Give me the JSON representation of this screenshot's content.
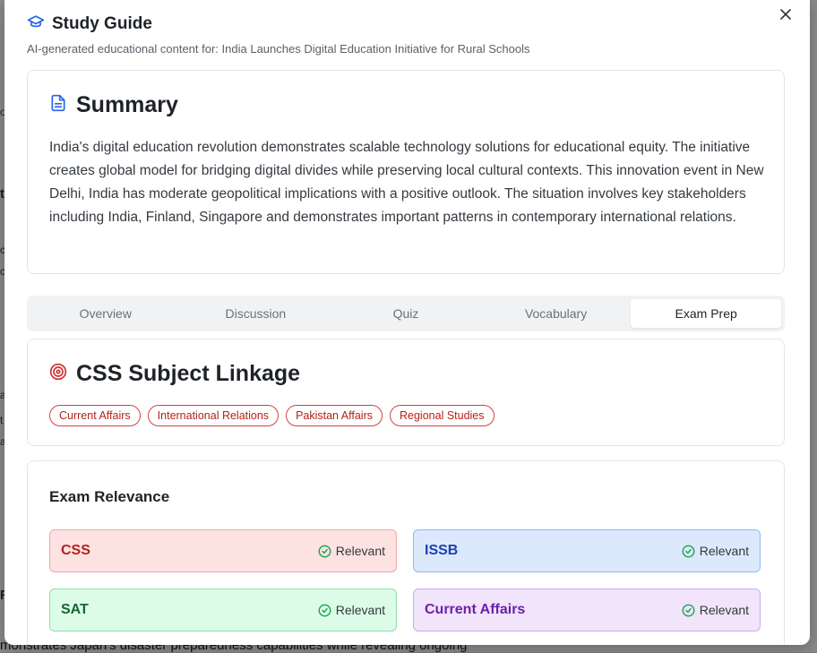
{
  "background": {
    "bottom_text": "monstrates Japan's disaster preparedness capabilities while revealing ongoing",
    "fragments": [
      "o",
      "t",
      "c",
      "c",
      "a",
      "t",
      "a",
      "F"
    ]
  },
  "header": {
    "title": "Study Guide",
    "subtitle": "AI-generated educational content for: India Launches Digital Education Initiative for Rural Schools",
    "icon": "graduation-cap-icon"
  },
  "summary": {
    "title": "Summary",
    "icon": "document-icon",
    "text": "India's digital education revolution demonstrates scalable technology solutions for educational equity. The initiative creates global model for bridging digital divides while preserving local cultural contexts. This innovation event in New Delhi, India has moderate geopolitical implications with a positive outlook. The situation involves key stakeholders including India, Finland, Singapore and demonstrates important patterns in contemporary international relations."
  },
  "tabs": [
    {
      "label": "Overview"
    },
    {
      "label": "Discussion"
    },
    {
      "label": "Quiz"
    },
    {
      "label": "Vocabulary"
    },
    {
      "label": "Exam Prep",
      "active": true
    }
  ],
  "linkage": {
    "title": "CSS Subject Linkage",
    "icon": "target-icon",
    "tags": [
      "Current Affairs",
      "International Relations",
      "Pakistan Affairs",
      "Regional Studies"
    ]
  },
  "exam": {
    "title": "Exam Relevance",
    "items": [
      {
        "name": "CSS",
        "status": "Relevant",
        "bg": "#fde2e2",
        "border": "#f3a3a3",
        "color": "#b42318"
      },
      {
        "name": "ISSB",
        "status": "Relevant",
        "bg": "#dce9fd",
        "border": "#93b8f3",
        "color": "#1e40af"
      },
      {
        "name": "SAT",
        "status": "Relevant",
        "bg": "#dcfce7",
        "border": "#8fdcaa",
        "color": "#166534"
      },
      {
        "name": "Current Affairs",
        "status": "Relevant",
        "bg": "#f1e4fb",
        "border": "#cfa9ee",
        "color": "#6b21a8"
      }
    ]
  },
  "colors": {
    "accent_blue": "#2563eb",
    "target_red": "#d32f2f",
    "check_green": "#16a34a"
  }
}
